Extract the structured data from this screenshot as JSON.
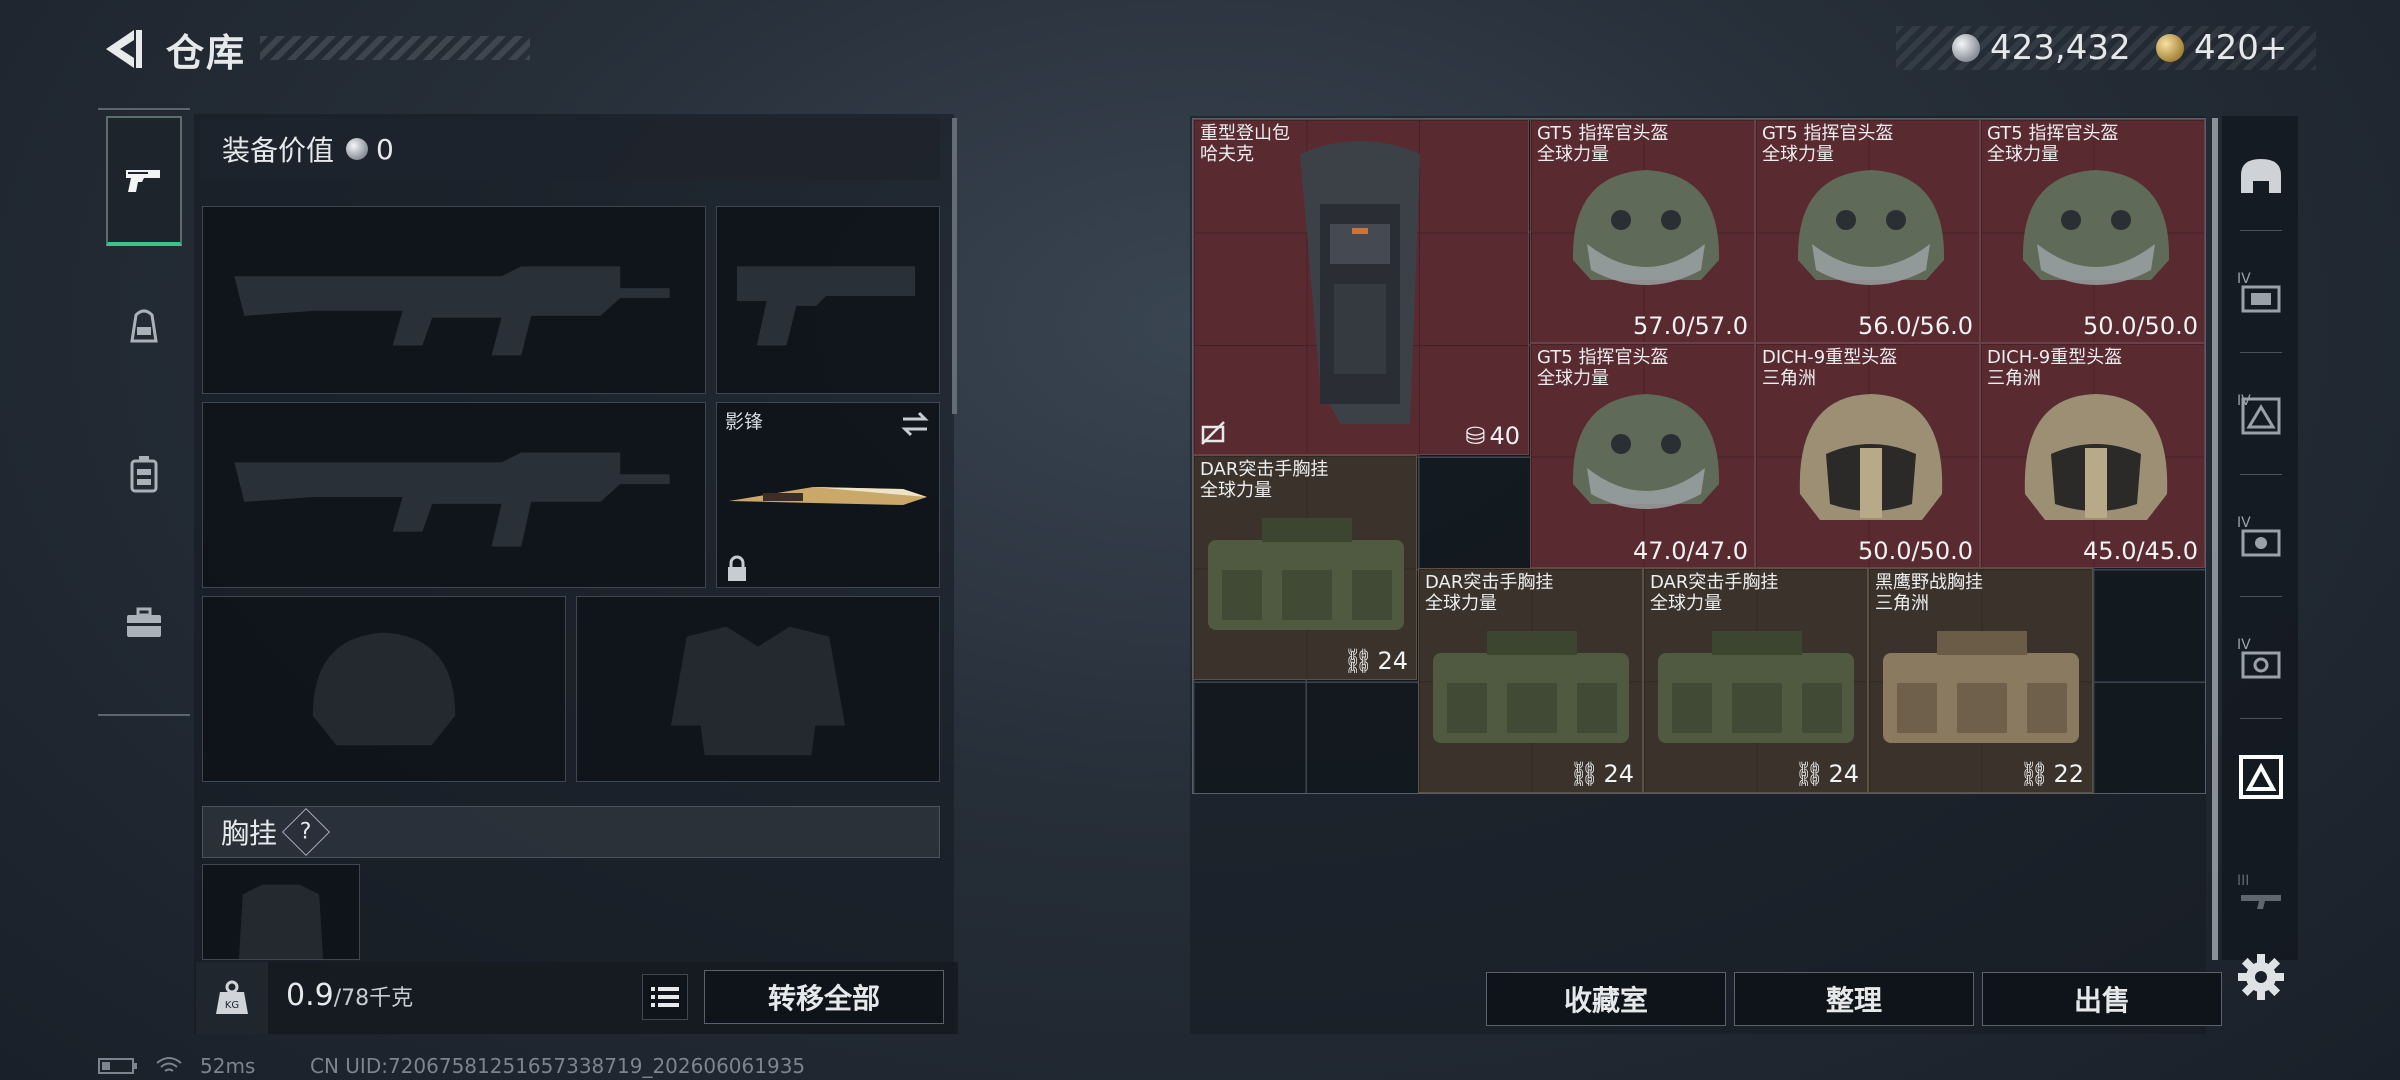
{
  "header": {
    "title": "仓库",
    "currencies": [
      {
        "icon": "silver-coin-icon",
        "value": "423,432"
      },
      {
        "icon": "gold-coin-icon",
        "value": "420+"
      }
    ]
  },
  "left_rail": [
    {
      "icon": "pistol-icon",
      "active": true
    },
    {
      "icon": "backpack-icon",
      "active": false
    },
    {
      "icon": "chest-rig-icon",
      "active": false
    },
    {
      "icon": "briefcase-icon",
      "active": false
    }
  ],
  "loadout": {
    "value_label": "装备价值",
    "value": "0",
    "melee_name": "影锋",
    "vest_label": "胸挂",
    "vest_help": "?",
    "weight_value": "0.9",
    "weight_max": "/78千克",
    "transfer_label": "转移全部"
  },
  "items": [
    {
      "name1": "重型登山包",
      "name2": "哈夫克",
      "capacity": "40"
    },
    {
      "name1": "GT5 指挥官头盔",
      "name2": "全球力量",
      "durability": "57.0/57.0"
    },
    {
      "name1": "GT5 指挥官头盔",
      "name2": "全球力量",
      "durability": "56.0/56.0"
    },
    {
      "name1": "GT5 指挥官头盔",
      "name2": "全球力量",
      "durability": "50.0/50.0"
    },
    {
      "name1": "GT5 指挥官头盔",
      "name2": "全球力量",
      "durability": "47.0/47.0"
    },
    {
      "name1": "DICH-9重型头盔",
      "name2": "三角洲",
      "durability": "50.0/50.0"
    },
    {
      "name1": "DICH-9重型头盔",
      "name2": "三角洲",
      "durability": "45.0/45.0"
    },
    {
      "name1": "DAR突击手胸挂",
      "name2": "全球力量",
      "capacity": "24"
    },
    {
      "name1": "DAR突击手胸挂",
      "name2": "全球力量",
      "capacity": "24"
    },
    {
      "name1": "DAR突击手胸挂",
      "name2": "全球力量",
      "capacity": "24"
    },
    {
      "name1": "黑鹰野战胸挂",
      "name2": "三角洲",
      "capacity": "22"
    }
  ],
  "right_rail": [
    {
      "icon": "helmet-tab-icon"
    },
    {
      "icon": "tier-4-case-icon",
      "label": "IV"
    },
    {
      "icon": "tier-4-rig-icon",
      "label": "IV"
    },
    {
      "icon": "tier-4-armor-icon",
      "label": "IV"
    },
    {
      "icon": "tier-4-gear-icon",
      "label": "IV"
    },
    {
      "icon": "rig-tab-icon",
      "active": true
    },
    {
      "icon": "tier-3-gun-icon",
      "label": "III"
    }
  ],
  "bottom_buttons": {
    "collection": "收藏室",
    "sort": "整理",
    "sell": "出售"
  },
  "status": {
    "ping": "52ms",
    "uid": "CN UID:7206758125165733871​9_202606061935"
  }
}
